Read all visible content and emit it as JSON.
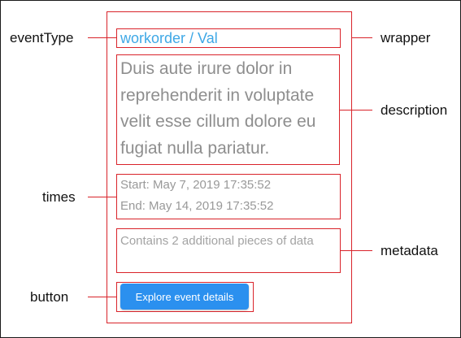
{
  "card": {
    "event_type": "workorder / Val",
    "description": "Duis aute irure dolor in reprehenderit in voluptate velit esse cillum dolore eu fugiat nulla pariatur.",
    "start": "Start: May 7, 2019 17:35:52",
    "end": "End: May 14, 2019 17:35:52",
    "metadata": "Contains 2 additional pieces of data",
    "button_label": "Explore event details"
  },
  "labels": {
    "event_type": "eventType",
    "times": "times",
    "button": "button",
    "wrapper": "wrapper",
    "description": "description",
    "metadata": "metadata"
  },
  "colors": {
    "annotation": "#d9232a",
    "event_type": "#3ea8e6",
    "button": "#2b90ef"
  }
}
